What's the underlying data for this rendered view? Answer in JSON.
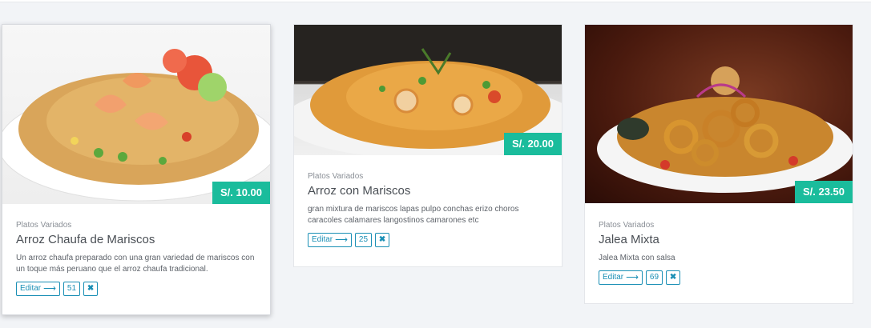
{
  "cards": [
    {
      "category": "Platos Variados",
      "title": "Arroz Chaufa de Mariscos",
      "description": "Un arroz chaufa preparado con una gran variedad de mariscos con un toque más peruano que el arroz chaufa tradicional.",
      "price": "S/. 10.00",
      "edit_label": "Editar",
      "count": "51",
      "delete_icon": "✖"
    },
    {
      "category": "Platos Variados",
      "title": "Arroz con Mariscos",
      "description": "gran mixtura de mariscos lapas pulpo conchas erizo choros caracoles calamares langostinos camarones etc",
      "price": "S/. 20.00",
      "edit_label": "Editar",
      "count": "25",
      "delete_icon": "✖"
    },
    {
      "category": "Platos Variados",
      "title": "Jalea Mixta",
      "description": "Jalea Mixta con salsa",
      "price": "S/. 23.50",
      "edit_label": "Editar",
      "count": "69",
      "delete_icon": "✖"
    }
  ],
  "icons": {
    "edit": "arrow-right-icon",
    "delete": "close-icon"
  },
  "colors": {
    "price_badge": "#1abc9c",
    "button": "#1a8fb5"
  }
}
